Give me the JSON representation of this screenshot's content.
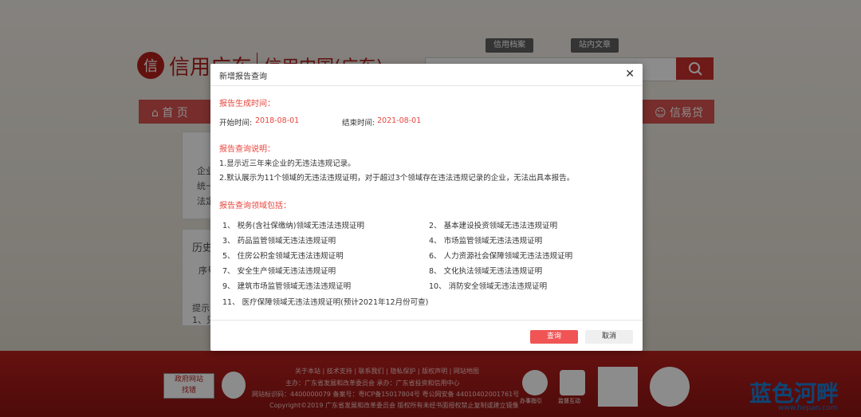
{
  "site": {
    "logo_text": "信用广东",
    "logo_text2": "信用中国(广东)",
    "tabs": [
      "信用档案",
      "站内文章"
    ],
    "nav_home": "首 页",
    "nav_xyd": "信易贷"
  },
  "bg_cards": {
    "lines": [
      "企业",
      "统一",
      "法定"
    ],
    "history": "历史",
    "serial": "序号",
    "hint": "提示",
    "hint2": "1、只"
  },
  "footer": {
    "links": "关于本站 | 技术支持 | 联系我们 | 隐私保护 | 版权声明 | 网站地图",
    "line2": "主办：广东省发展和改革委员会   承办：广东省投资和信用中心",
    "line3": "网站标识码：4400000079   备案号：粤ICP备15017804号   粤公网安备 44010402001761号",
    "line4": "Copyright©2019 广东省发展和改革委员会  版权所有未经书面授权禁止复制或建立镜像",
    "gov_badge_1": "政府网站",
    "gov_badge_2": "找错",
    "icon_label_1": "办事指引",
    "icon_label_2": "监督互动",
    "watermark": "蓝色河畔",
    "watermark_sub": "www.hepan.com"
  },
  "modal": {
    "title": "新增报告查询",
    "section_time": "报告生成时间：",
    "start_label": "开始时间:",
    "start_value": "2018-08-01",
    "end_label": "结束时间:",
    "end_value": "2021-08-01",
    "section_desc": "报告查询说明：",
    "desc1": "1.显示近三年来企业的无违法违规记录。",
    "desc2": "2.默认展示为11个领域的无违法违规证明，对于超过3个领域存在违法违规记录的企业，无法出具本报告。",
    "section_fields": "报告查询领域包括：",
    "fields": [
      "1、 税务(含社保缴纳)领域无违法违规证明",
      "2、 基本建设投资领域无违法违规证明",
      "3、 药品监管领域无违法违规证明",
      "4、 市场监管领域无违法违规证明",
      "5、 住房公积金领域无违法违规证明",
      "6、 人力资源社会保障领域无违法违规证明",
      "7、 安全生产领域无违法违规证明",
      "8、 文化执法领域无违法违规证明",
      "9、 建筑市场监管领域无违法违规证明",
      "10、 消防安全领域无违法违规证明",
      "11、 医疗保障领域无违法违规证明(预计2021年12月份可查)"
    ],
    "btn_query": "查询",
    "btn_cancel": "取消"
  }
}
